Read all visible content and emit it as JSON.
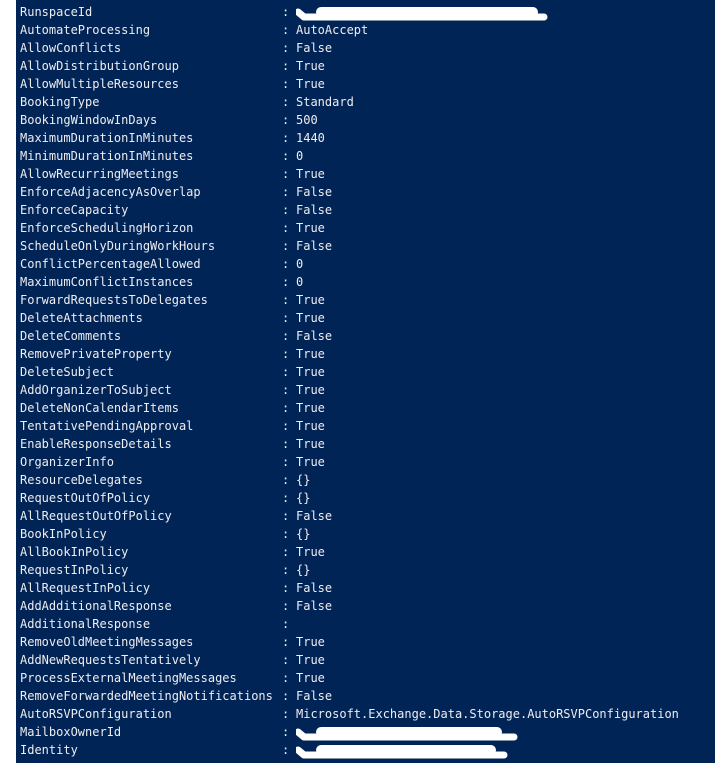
{
  "console": {
    "properties": [
      {
        "key": "RunspaceId",
        "value": "",
        "redacted": true
      },
      {
        "key": "AutomateProcessing",
        "value": "AutoAccept"
      },
      {
        "key": "AllowConflicts",
        "value": "False"
      },
      {
        "key": "AllowDistributionGroup",
        "value": "True"
      },
      {
        "key": "AllowMultipleResources",
        "value": "True"
      },
      {
        "key": "BookingType",
        "value": "Standard"
      },
      {
        "key": "BookingWindowInDays",
        "value": "500"
      },
      {
        "key": "MaximumDurationInMinutes",
        "value": "1440"
      },
      {
        "key": "MinimumDurationInMinutes",
        "value": "0"
      },
      {
        "key": "AllowRecurringMeetings",
        "value": "True"
      },
      {
        "key": "EnforceAdjacencyAsOverlap",
        "value": "False"
      },
      {
        "key": "EnforceCapacity",
        "value": "False"
      },
      {
        "key": "EnforceSchedulingHorizon",
        "value": "True"
      },
      {
        "key": "ScheduleOnlyDuringWorkHours",
        "value": "False"
      },
      {
        "key": "ConflictPercentageAllowed",
        "value": "0"
      },
      {
        "key": "MaximumConflictInstances",
        "value": "0"
      },
      {
        "key": "ForwardRequestsToDelegates",
        "value": "True"
      },
      {
        "key": "DeleteAttachments",
        "value": "True"
      },
      {
        "key": "DeleteComments",
        "value": "False"
      },
      {
        "key": "RemovePrivateProperty",
        "value": "True"
      },
      {
        "key": "DeleteSubject",
        "value": "True"
      },
      {
        "key": "AddOrganizerToSubject",
        "value": "True"
      },
      {
        "key": "DeleteNonCalendarItems",
        "value": "True"
      },
      {
        "key": "TentativePendingApproval",
        "value": "True"
      },
      {
        "key": "EnableResponseDetails",
        "value": "True"
      },
      {
        "key": "OrganizerInfo",
        "value": "True"
      },
      {
        "key": "ResourceDelegates",
        "value": "{}"
      },
      {
        "key": "RequestOutOfPolicy",
        "value": "{}"
      },
      {
        "key": "AllRequestOutOfPolicy",
        "value": "False"
      },
      {
        "key": "BookInPolicy",
        "value": "{}"
      },
      {
        "key": "AllBookInPolicy",
        "value": "True"
      },
      {
        "key": "RequestInPolicy",
        "value": "{}"
      },
      {
        "key": "AllRequestInPolicy",
        "value": "False"
      },
      {
        "key": "AddAdditionalResponse",
        "value": "False"
      },
      {
        "key": "AdditionalResponse",
        "value": ""
      },
      {
        "key": "RemoveOldMeetingMessages",
        "value": "True"
      },
      {
        "key": "AddNewRequestsTentatively",
        "value": "True"
      },
      {
        "key": "ProcessExternalMeetingMessages",
        "value": "True"
      },
      {
        "key": "RemoveForwardedMeetingNotifications",
        "value": "False"
      },
      {
        "key": "AutoRSVPConfiguration",
        "value": "Microsoft.Exchange.Data.Storage.AutoRSVPConfiguration"
      },
      {
        "key": "MailboxOwnerId",
        "value": "",
        "redacted": true
      },
      {
        "key": "Identity",
        "value": "",
        "redacted": true
      }
    ],
    "separator": ":",
    "colors": {
      "background": "#012456",
      "text": "#eeedf0",
      "redaction": "#ffffff"
    }
  }
}
